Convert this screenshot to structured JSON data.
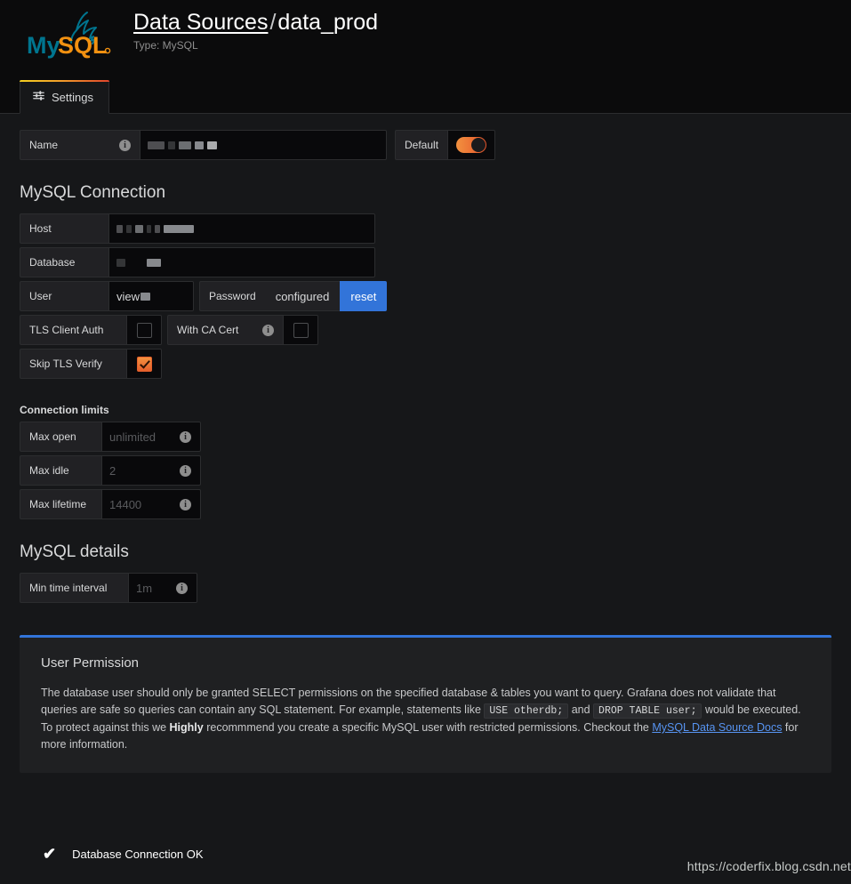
{
  "header": {
    "logo_alt": "MySQL",
    "breadcrumb_link": "Data Sources",
    "breadcrumb_separator": "/",
    "datasource_name": "data_prod",
    "subtitle": "Type: MySQL",
    "tabs": [
      {
        "label": "Settings",
        "icon": "sliders-icon",
        "active": true
      }
    ]
  },
  "name_row": {
    "label": "Name",
    "value": "",
    "value_redacted": true,
    "default_label": "Default",
    "default_on": true
  },
  "connection": {
    "section_title": "MySQL Connection",
    "host": {
      "label": "Host",
      "value": "",
      "value_redacted": true
    },
    "database": {
      "label": "Database",
      "value": "",
      "value_redacted": true
    },
    "user": {
      "label": "User",
      "value": "view",
      "value_redacted": true
    },
    "password": {
      "label": "Password",
      "value": "configured",
      "reset_label": "reset"
    },
    "tls_client_auth": {
      "label": "TLS Client Auth",
      "checked": false
    },
    "with_ca_cert": {
      "label": "With CA Cert",
      "checked": false
    },
    "skip_tls_verify": {
      "label": "Skip TLS Verify",
      "checked": true
    }
  },
  "connection_limits": {
    "section_title": "Connection limits",
    "max_open": {
      "label": "Max open",
      "placeholder": "unlimited"
    },
    "max_idle": {
      "label": "Max idle",
      "placeholder": "2"
    },
    "max_lifetime": {
      "label": "Max lifetime",
      "placeholder": "14400"
    }
  },
  "mysql_details": {
    "section_title": "MySQL details",
    "min_time_interval": {
      "label": "Min time interval",
      "placeholder": "1m"
    }
  },
  "alert": {
    "title": "User Permission",
    "text_1": "The database user should only be granted SELECT permissions on the specified database & tables you want to query. Grafana does not validate that queries are safe so queries can contain any SQL statement. For example, statements like ",
    "code_1": "USE otherdb;",
    "text_2": " and ",
    "code_2": "DROP TABLE user;",
    "text_3": " would be executed. To protect against this we ",
    "bold_1": "Highly",
    "text_4": " recommmend you create a specific MySQL user with restricted permissions. Checkout the ",
    "link_label": "MySQL Data Source Docs",
    "text_5": " for more information."
  },
  "status": {
    "icon": "check-icon",
    "message": "Database Connection OK",
    "color": "#299c46"
  },
  "watermark": {
    "text": "https://coderfix.blog.csdn.net"
  }
}
